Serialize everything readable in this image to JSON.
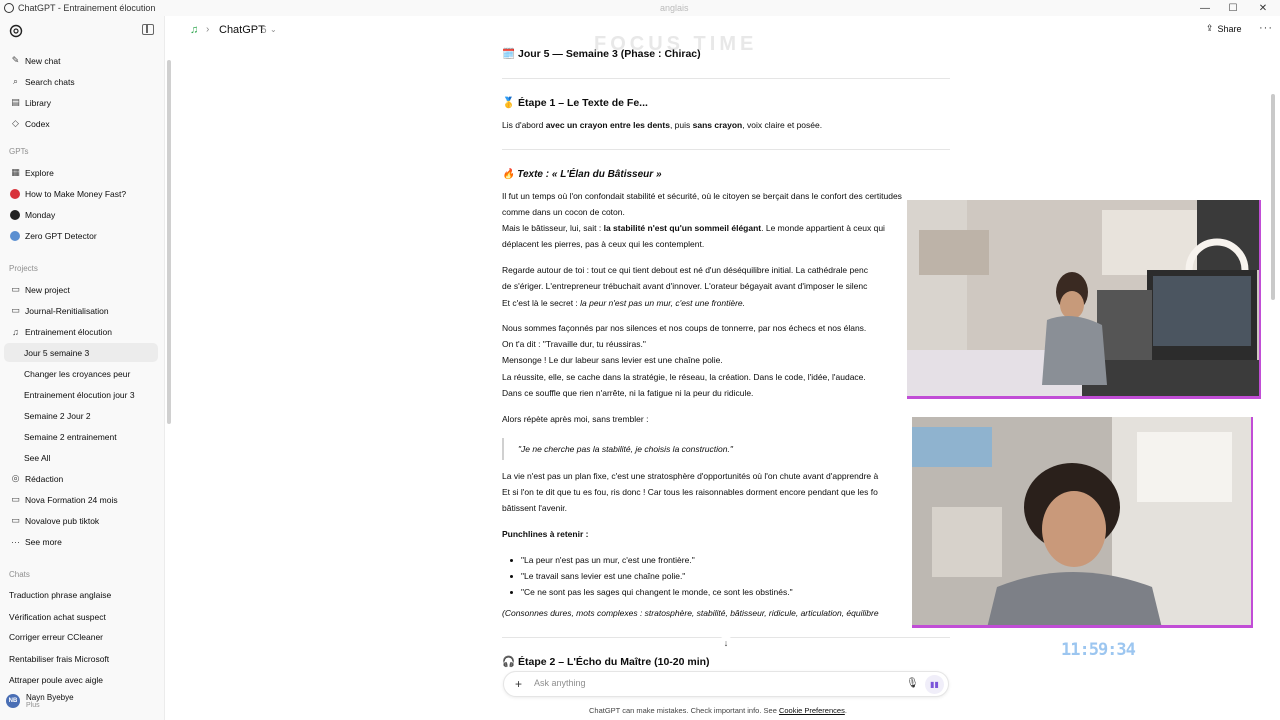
{
  "window": {
    "title": "ChatGPT - Entrainement élocution",
    "overlay_tab": "anglais",
    "controls": [
      "—",
      "☐",
      "✕"
    ]
  },
  "sidebar": {
    "top_items": [
      {
        "icon": "✎",
        "label": "New chat"
      },
      {
        "icon": "⌕",
        "label": "Search chats"
      },
      {
        "icon": "▤",
        "label": "Library"
      },
      {
        "icon": "◇",
        "label": "Codex"
      }
    ],
    "gpts_heading": "GPTs",
    "gpts": [
      {
        "icon": "▦",
        "label": "Explore",
        "color": "#444444"
      },
      {
        "icon": "",
        "label": "How to Make Money Fast?",
        "color": "#d8323a"
      },
      {
        "icon": "",
        "label": "Monday",
        "color": "#222222"
      },
      {
        "icon": "",
        "label": "Zero GPT Detector",
        "color": "#5b8fd1"
      }
    ],
    "projects_heading": "Projects",
    "projects": [
      {
        "icon": "▭",
        "label": "New project",
        "sub": false
      },
      {
        "icon": "▭",
        "label": "Journal-Renitialisation",
        "sub": false
      },
      {
        "icon": "♫",
        "label": "Entrainement élocution",
        "sub": false
      },
      {
        "icon": "",
        "label": "Jour 5 semaine 3",
        "sub": true,
        "active": true
      },
      {
        "icon": "",
        "label": "Changer les croyances peur",
        "sub": true
      },
      {
        "icon": "",
        "label": "Entrainement élocution jour 3",
        "sub": true
      },
      {
        "icon": "",
        "label": "Semaine 2 Jour 2",
        "sub": true
      },
      {
        "icon": "",
        "label": "Semaine 2 entrainement",
        "sub": true
      },
      {
        "icon": "",
        "label": "See All",
        "sub": true
      },
      {
        "icon": "◎",
        "label": "Rédaction",
        "sub": false
      },
      {
        "icon": "▭",
        "label": "Nova Formation 24 mois",
        "sub": false
      },
      {
        "icon": "▭",
        "label": "Novalove pub tiktok",
        "sub": false
      },
      {
        "icon": "···",
        "label": "See more",
        "sub": false
      }
    ],
    "chats_heading": "Chats",
    "chats": [
      "Traduction phrase anglaise",
      "Vérification achat suspect",
      "Corriger erreur CCleaner",
      "Rentabiliser frais Microsoft",
      "Attraper poule avec aigle"
    ],
    "user": {
      "initials": "NB",
      "name": "Nayn Byebye",
      "plan": "Plus"
    }
  },
  "header": {
    "model_label": "ChatGPT",
    "model_version": "5",
    "share_label": "Share"
  },
  "ghost": {
    "focus": "FOCUS TIME"
  },
  "content": {
    "day_title": "🗓️ Jour 5 — Semaine 3 (Phase : Chirac)",
    "step1_title": "🥇 Étape 1 – Le Texte de Fe...",
    "step1_intro_a": "Lis d'abord ",
    "step1_intro_b": "avec un crayon entre les dents",
    "step1_intro_c": ", puis ",
    "step1_intro_d": "sans crayon",
    "step1_intro_e": ", voix claire et posée.",
    "text_title": "🔥 Texte : « L'Élan du Bâtisseur »",
    "p1_l1": "Il fut un temps où l'on confondait stabilité et sécurité, où le citoyen se berçait dans le confort des certitudes",
    "p1_l2": "comme dans un cocon de coton.",
    "p1_l3a": "Mais le bâtisseur, lui, sait : ",
    "p1_l3b": "la stabilité n'est qu'un sommeil élégant",
    "p1_l3c": ". Le monde appartient à ceux qui",
    "p1_l4": "déplacent les pierres, pas à ceux qui les contemplent.",
    "p2_l1": "Regarde autour de toi : tout ce qui tient debout est né d'un déséquilibre initial. La cathédrale penc",
    "p2_l2": "de s'ériger. L'entrepreneur trébuchait avant d'innover. L'orateur bégayait avant d'imposer le silenc",
    "p2_l3a": "Et c'est là le secret : ",
    "p2_l3b": "la peur n'est pas un mur, c'est une frontière.",
    "p3_l1": "Nous sommes façonnés par nos silences et nos coups de tonnerre, par nos échecs et nos élans.",
    "p3_l2": "On t'a dit : \"Travaille dur, tu réussiras.\"",
    "p3_l3": "Mensonge ! Le dur labeur sans levier est une chaîne polie.",
    "p3_l4": "La réussite, elle, se cache dans la stratégie, le réseau, la création. Dans le code, l'idée, l'audace.",
    "p3_l5": "Dans ce souffle que rien n'arrête, ni la fatigue ni la peur du ridicule.",
    "repeat": "Alors répète après moi, sans trembler :",
    "quote": "\"Je ne cherche pas la stabilité, je choisis la construction.\"",
    "p4_l1": "La vie n'est pas un plan fixe, c'est une stratosphère d'opportunités où l'on chute avant d'apprendre à",
    "p4_l2": "Et si l'on te dit que tu es fou, ris donc ! Car tous les raisonnables dorment encore pendant que les fo",
    "p4_l3": "bâtissent l'avenir.",
    "punch_title": "Punchlines à retenir :",
    "punchlines": [
      "\"La peur n'est pas un mur, c'est une frontière.\"",
      "\"Le travail sans levier est une chaîne polie.\"",
      "\"Ce ne sont pas les sages qui changent le monde, ce sont les obstinés.\""
    ],
    "consonnes": "(Consonnes dures, mots complexes : stratosphère, stabilité, bâtisseur, ridicule, articulation, équilibre",
    "step2_title": "🎧 Étape 2 – L'Écho du Maître (10-20 min)"
  },
  "composer": {
    "placeholder": "Ask anything",
    "disclaimer_a": "ChatGPT can make mistakes. Check important info. See ",
    "disclaimer_link": "Cookie Preferences",
    "disclaimer_b": "."
  },
  "overlay": {
    "clock": "11:59:34",
    "accent": "#c14dd6",
    "clock_color": "#9cc6f0"
  }
}
